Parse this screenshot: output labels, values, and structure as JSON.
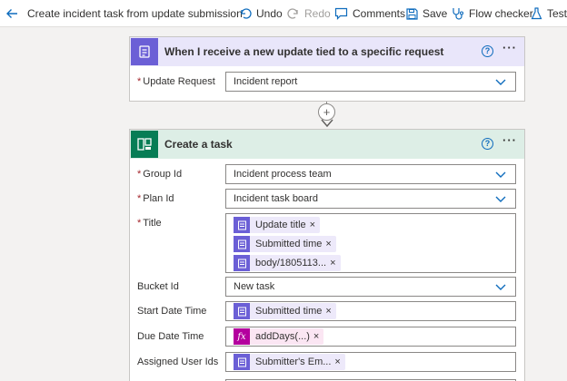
{
  "app": {
    "flow_title": "Create incident task from update submission"
  },
  "toolbar": {
    "undo": "Undo",
    "redo": "Redo",
    "comments": "Comments",
    "save": "Save",
    "flow_checker": "Flow checker",
    "test": "Test"
  },
  "trigger": {
    "title": "When I receive a new update tied to a specific request",
    "fields": {
      "update_request": {
        "label": "Update Request",
        "value": "Incident report"
      }
    }
  },
  "action": {
    "title": "Create a task",
    "fields": {
      "group_id": {
        "label": "Group Id",
        "value": "Incident process team"
      },
      "plan_id": {
        "label": "Plan Id",
        "value": "Incident task board"
      },
      "title": {
        "label": "Title",
        "tokens": [
          "Update title",
          "Submitted time",
          "body/1805113..."
        ]
      },
      "bucket_id": {
        "label": "Bucket Id",
        "value": "New task"
      },
      "start_date_time": {
        "label": "Start Date Time",
        "token": "Submitted time"
      },
      "due_date_time": {
        "label": "Due Date Time",
        "token": "addDays(...)"
      },
      "assigned_user_ids": {
        "label": "Assigned User Ids",
        "token": "Submitter's Em..."
      }
    }
  },
  "icons": {
    "help": "?",
    "more": "···",
    "plus": "+",
    "remove": "×",
    "fx": "fx"
  },
  "colors": {
    "accent": "#0f6cbd",
    "trigger_header": "#e9e6fa",
    "trigger_icon": "#6b5fd6",
    "action_header": "#ddeee6",
    "action_icon": "#077d55",
    "token_bg": "#ede9fa",
    "expression_icon": "#b4009e",
    "required": "#a4262c"
  }
}
